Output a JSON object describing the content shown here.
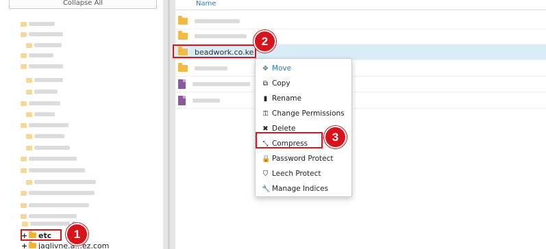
{
  "left_panel": {
    "collapse_label": "Collapse All",
    "visible_items": [
      {
        "label": "etc",
        "expand": "+"
      },
      {
        "label": "jaglivne.a...ez.com",
        "expand": "+"
      }
    ],
    "partial_item_text": "e"
  },
  "file_list": {
    "column_name_header": "Name",
    "selected_file": "beadwork.co.ke"
  },
  "context_menu": {
    "items": [
      {
        "label": "Move",
        "icon": "move-arrows-icon",
        "glyph": "✥"
      },
      {
        "label": "Copy",
        "icon": "copy-icon",
        "glyph": "⧉"
      },
      {
        "label": "Rename",
        "icon": "file-icon",
        "glyph": "▮"
      },
      {
        "label": "Change Permissions",
        "icon": "key-icon",
        "glyph": "⚿"
      },
      {
        "label": "Delete",
        "icon": "x-icon",
        "glyph": "✖"
      },
      {
        "label": "Compress",
        "icon": "compress-icon",
        "glyph": "⤡"
      },
      {
        "label": "Password Protect",
        "icon": "lock-icon",
        "glyph": "🔒"
      },
      {
        "label": "Leech Protect",
        "icon": "shield-icon",
        "glyph": "⛉"
      },
      {
        "label": "Manage Indices",
        "icon": "wrench-icon",
        "glyph": "🔧"
      }
    ]
  },
  "annotations": {
    "step1": "1",
    "step2": "2",
    "step3": "3",
    "color": "#e0131a"
  },
  "colors": {
    "selected_row": "#d9edf7",
    "link": "#337ab7",
    "folder": "#f4b942"
  }
}
